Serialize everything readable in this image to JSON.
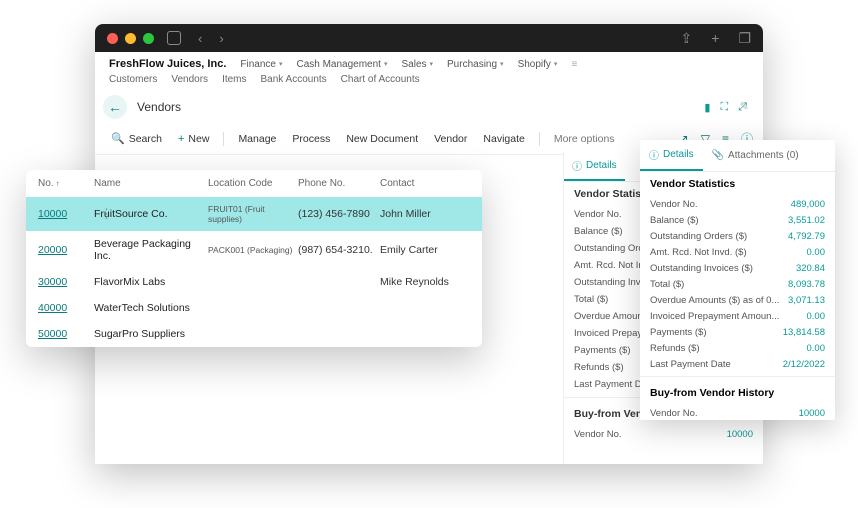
{
  "company": "FreshFlow Juices, Inc.",
  "topnav": [
    "Finance",
    "Cash Management",
    "Sales",
    "Purchasing",
    "Shopify"
  ],
  "subnav": [
    "Customers",
    "Vendors",
    "Items",
    "Bank Accounts",
    "Chart of Accounts"
  ],
  "crumb": "Vendors",
  "toolbar": {
    "search": "Search",
    "new": "New",
    "manage": "Manage",
    "process": "Process",
    "newdoc": "New Document",
    "vendor": "Vendor",
    "navigate": "Navigate",
    "more": "More options"
  },
  "list": {
    "headers": {
      "no": "No.",
      "name": "Name",
      "loc": "Location Code",
      "phone": "Phone No.",
      "contact": "Contact"
    },
    "rows": [
      {
        "no": "10000",
        "name": "FruitSource Co.",
        "loc": "FRUIT01 (Fruit supplies)",
        "phone": "(123) 456-7890",
        "contact": "John Miller",
        "sel": true
      },
      {
        "no": "20000",
        "name": "Beverage Packaging Inc.",
        "loc": "PACK001 (Packaging)",
        "phone": "(987) 654-3210.",
        "contact": "Emily Carter"
      },
      {
        "no": "30000",
        "name": "FlavorMix Labs",
        "loc": "",
        "phone": "",
        "contact": "Mike Reynolds"
      },
      {
        "no": "40000",
        "name": "WaterTech Solutions",
        "loc": "",
        "phone": "",
        "contact": ""
      },
      {
        "no": "50000",
        "name": "SugarPro Suppliers",
        "loc": "",
        "phone": "",
        "contact": ""
      }
    ]
  },
  "tabs": {
    "details": "Details",
    "attachments": "Attachments (0)"
  },
  "statsTitle": "Vendor Statistics",
  "stats": [
    {
      "lbl": "Vendor No.",
      "val": ""
    },
    {
      "lbl": "Balance ($)",
      "val": ""
    },
    {
      "lbl": "Outstanding Orders",
      "val": ""
    },
    {
      "lbl": "Amt. Rcd. Not Invd.",
      "val": ""
    },
    {
      "lbl": "Outstanding Invoice",
      "val": ""
    },
    {
      "lbl": "Total ($)",
      "val": ""
    },
    {
      "lbl": "Overdue Amounts ($)",
      "val": ""
    },
    {
      "lbl": "Invoiced Prepayment",
      "val": ""
    },
    {
      "lbl": "Payments ($)",
      "val": ""
    },
    {
      "lbl": "Refunds ($)",
      "val": ""
    },
    {
      "lbl": "Last Payment Date",
      "val": ""
    }
  ],
  "histTitle": "Buy-from Vendor History",
  "hist": [
    {
      "lbl": "Vendor No.",
      "val": "10000"
    }
  ],
  "fly": {
    "statsTitle": "Vendor Statistics",
    "stats": [
      {
        "lbl": "Vendor No.",
        "val": "489,000"
      },
      {
        "lbl": "Balance ($)",
        "val": "3,551.02"
      },
      {
        "lbl": "Outstanding Orders ($)",
        "val": "4,792.79"
      },
      {
        "lbl": "Amt. Rcd. Not Invd. ($)",
        "val": "0.00"
      },
      {
        "lbl": "Outstanding Invoices ($)",
        "val": "320.84"
      },
      {
        "lbl": "Total ($)",
        "val": "8,093.78"
      },
      {
        "lbl": "Overdue Amounts ($) as of 0...",
        "val": "3,071.13"
      },
      {
        "lbl": "Invoiced Prepayment Amoun...",
        "val": "0.00"
      },
      {
        "lbl": "Payments ($)",
        "val": "13,814.58"
      },
      {
        "lbl": "Refunds ($)",
        "val": "0.00"
      },
      {
        "lbl": "Last Payment Date",
        "val": "2/12/2022"
      }
    ],
    "histTitle": "Buy-from Vendor History",
    "hist": [
      {
        "lbl": "Vendor No.",
        "val": "10000"
      }
    ]
  }
}
